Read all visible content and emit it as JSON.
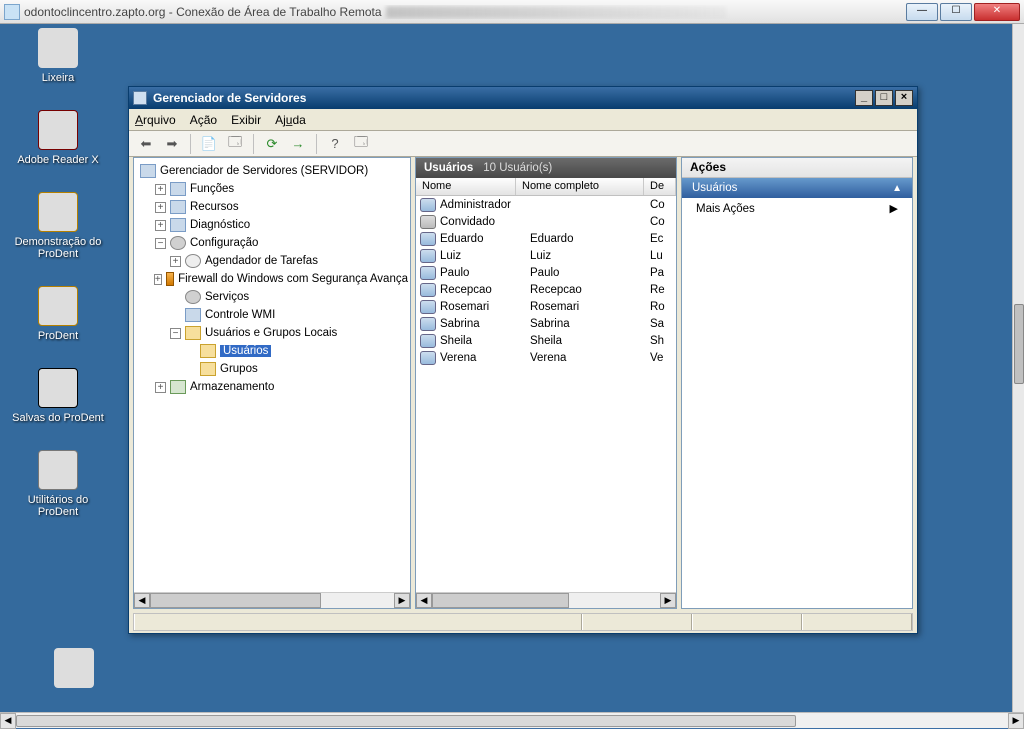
{
  "rdp": {
    "title": "odontoclincentro.zapto.org - Conexão de Área de Trabalho Remota"
  },
  "desktop_icons": [
    {
      "label": "Lixeira",
      "icon": "ic-bin"
    },
    {
      "label": "Adobe Reader X",
      "icon": "ic-acro"
    },
    {
      "label": "Demonstração do ProDent",
      "icon": "ic-pd"
    },
    {
      "label": "ProDent",
      "icon": "ic-pd"
    },
    {
      "label": "Salvas do ProDent",
      "icon": "ic-floppy"
    },
    {
      "label": "Utilitários do ProDent",
      "icon": "ic-wrench"
    }
  ],
  "window": {
    "title": "Gerenciador de Servidores",
    "menu": [
      "Arquivo",
      "Ação",
      "Exibir",
      "Ajuda"
    ],
    "tree": {
      "root": "Gerenciador de Servidores (SERVIDOR)",
      "items": {
        "funcoes": "Funções",
        "recursos": "Recursos",
        "diagnostico": "Diagnóstico",
        "config": "Configuração",
        "agendador": "Agendador de Tarefas",
        "firewall": "Firewall do Windows com Segurança Avança",
        "servicos": "Serviços",
        "wmi": "Controle WMI",
        "usergroups": "Usuários e Grupos Locais",
        "usuarios": "Usuários",
        "grupos": "Grupos",
        "armazen": "Armazenamento"
      }
    },
    "list": {
      "header": "Usuários",
      "count": "10 Usuário(s)",
      "columns": {
        "name": "Nome",
        "fullname": "Nome completo",
        "desc": "De"
      },
      "rows": [
        {
          "name": "Administrador",
          "full": "",
          "desc": "Co",
          "icon": "ic-user"
        },
        {
          "name": "Convidado",
          "full": "",
          "desc": "Co",
          "icon": "ic-user-dim"
        },
        {
          "name": "Eduardo",
          "full": "Eduardo",
          "desc": "Ec",
          "icon": "ic-user"
        },
        {
          "name": "Luiz",
          "full": "Luiz",
          "desc": "Lu",
          "icon": "ic-user"
        },
        {
          "name": "Paulo",
          "full": "Paulo",
          "desc": "Pa",
          "icon": "ic-user"
        },
        {
          "name": "Recepcao",
          "full": "Recepcao",
          "desc": "Re",
          "icon": "ic-user"
        },
        {
          "name": "Rosemari",
          "full": "Rosemari",
          "desc": "Ro",
          "icon": "ic-user"
        },
        {
          "name": "Sabrina",
          "full": "Sabrina",
          "desc": "Sa",
          "icon": "ic-user"
        },
        {
          "name": "Sheila",
          "full": "Sheila",
          "desc": "Sh",
          "icon": "ic-user"
        },
        {
          "name": "Verena",
          "full": "Verena",
          "desc": "Ve",
          "icon": "ic-user"
        }
      ]
    },
    "actions": {
      "header": "Ações",
      "section": "Usuários",
      "item": "Mais Ações"
    }
  }
}
